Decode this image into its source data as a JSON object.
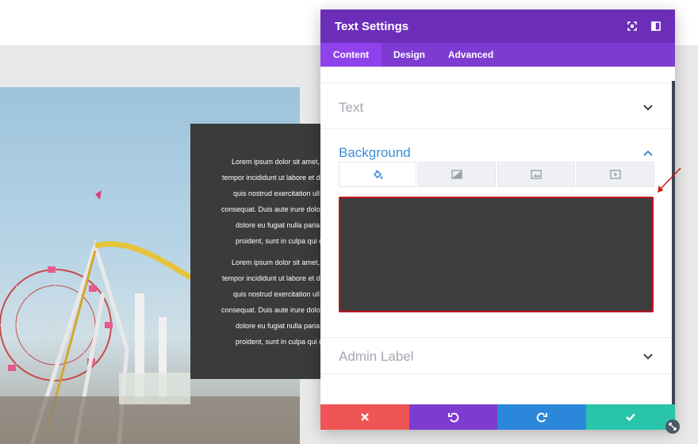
{
  "colors": {
    "header": "#6c2eb9",
    "tabs_bar": "#7e3bd0",
    "active_tab": "#8f42ec",
    "accent_blue": "#3d8ed6",
    "muted_text": "#a2a8b0",
    "preview_bg": "#3d3d3d",
    "highlight_border": "#c1151d",
    "cancel": "#ef5555",
    "undo": "#7e3bd0",
    "redo": "#2b87da",
    "save": "#29c4a9"
  },
  "preview_text": {
    "paragraphs": [
      [
        "Lorem ipsum dolor sit amet,",
        "tempor incididunt ut labore et d",
        "quis nostrud exercitation ull",
        "consequat. Duis aute irure dolo",
        "dolore eu fugiat nulla paria",
        "proident, sunt in culpa qui d"
      ],
      [
        "Lorem ipsum dolor sit amet,",
        "tempor incididunt ut labore et d",
        "quis nostrud exercitation ull",
        "consequat. Duis aute irure dolo",
        "dolore eu fugiat nulla paria",
        "proident, sunt in culpa qui d"
      ]
    ]
  },
  "panel": {
    "title": "Text Settings",
    "header_icons": [
      "expand-icon",
      "split-view-icon"
    ],
    "tabs": [
      {
        "label": "Content",
        "active": true
      },
      {
        "label": "Design",
        "active": false
      },
      {
        "label": "Advanced",
        "active": false
      }
    ],
    "sections": {
      "text": {
        "title": "Text",
        "expanded": false
      },
      "background": {
        "title": "Background",
        "expanded": true,
        "type_tabs": [
          "color-icon",
          "gradient-icon",
          "image-icon",
          "video-icon"
        ],
        "active_type": "color-icon"
      },
      "admin_label": {
        "title": "Admin Label",
        "expanded": false
      }
    },
    "footer_buttons": [
      "cancel-icon",
      "undo-icon",
      "redo-icon",
      "save-icon"
    ]
  }
}
